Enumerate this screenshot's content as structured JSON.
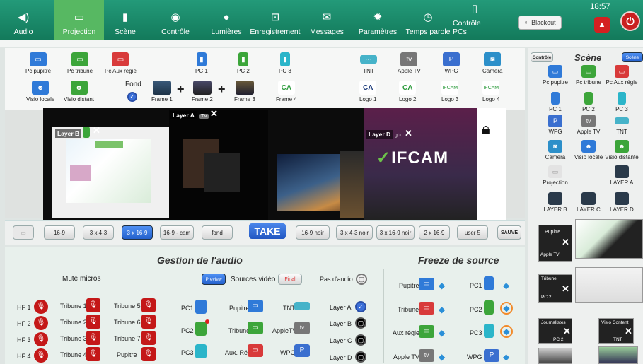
{
  "nav": [
    {
      "label": "Audio",
      "icon": "speaker-icon",
      "glyph": "◀)"
    },
    {
      "label": "Projection",
      "icon": "projector-icon",
      "glyph": "▭"
    },
    {
      "label": "Scène",
      "icon": "screen-icon",
      "glyph": "▮"
    },
    {
      "label": "Contrôle",
      "icon": "eye-icon",
      "glyph": "◉"
    },
    {
      "label": "Lumières",
      "icon": "bulb-icon",
      "glyph": "●"
    },
    {
      "label": "Enregistrement",
      "icon": "record-icon",
      "glyph": "⊡"
    },
    {
      "label": "Messages",
      "icon": "envelope-icon",
      "glyph": "✉"
    },
    {
      "label": "Paramètres",
      "icon": "gear-icon",
      "glyph": "✹"
    },
    {
      "label": "Temps parole",
      "icon": "clock-icon",
      "glyph": "◷"
    },
    {
      "label": "Contrôle PCs",
      "icon": "mouse-icon",
      "glyph": "▯"
    }
  ],
  "blackout": "Blackout",
  "time": "18:57",
  "sources_row1": [
    "Pc pupitre",
    "Pc tribune",
    "Pc Aux régie",
    "PC 1",
    "PC 2",
    "PC 3",
    "TNT",
    "Apple TV",
    "WPG",
    "Camera"
  ],
  "sources_row2": {
    "visio_locale": "Visio locale",
    "visio_distant": "Visio distant",
    "fond": "Fond",
    "frame1": "Frame 1",
    "frame2": "Frame 2",
    "frame3": "Frame 3",
    "frame4": "Frame 4",
    "logo1": "Logo 1",
    "logo2": "Logo 2",
    "logo3": "Logo 3",
    "logo4": "Logo 4",
    "plus": "+"
  },
  "layers": {
    "a": "Layer A",
    "b": "Layer B",
    "d": "Layer D",
    "ifcam": "IFCAM",
    "x": "✕",
    "tv_badge": "TV",
    "gtx_badge": "gtx"
  },
  "presets": [
    "16-9",
    "3 x 4-3",
    "3 x 16-9",
    "16-9 - cam",
    "fond",
    "16-9 noir",
    "3 x 4-3 noir",
    "3 x 16-9 noir",
    "2 x 16-9",
    "user 5",
    "SAUVE"
  ],
  "take": "TAKE",
  "audio": {
    "title": "Gestion de l'audio",
    "mute": "Mute micros",
    "hf": [
      "HF 1",
      "HF 2",
      "HF 3",
      "HF 4"
    ],
    "tribune_left": [
      "Tribune 1",
      "Tribune 2",
      "Tribune 3",
      "Tribune 4"
    ],
    "tribune_right": [
      "Tribune 5",
      "Tribune 6",
      "Tribune 7",
      "Pupitre"
    ],
    "preview_btn": "Preview",
    "sources_video": "Sources vidéo",
    "final_btn": "Final",
    "pas_audio": "Pas d'audio",
    "col1": [
      "PC1",
      "PC2",
      "PC3"
    ],
    "col2": [
      "Pupitre",
      "Tribune",
      "Aux. Rég"
    ],
    "col3": [
      "TNT",
      "AppleTV",
      "WPG"
    ],
    "layers": [
      "Layer A",
      "Layer B",
      "Layer C",
      "Layer D"
    ]
  },
  "freeze": {
    "title": "Freeze de source",
    "left": [
      "Pupitre",
      "Tribune",
      "Aux régie",
      "Apple TV"
    ],
    "right": [
      "PC1",
      "PC2",
      "PC3",
      "WPG"
    ]
  },
  "right": {
    "controle": "Contrôle",
    "scene_title": "Scène",
    "scene_btn": "Scène",
    "items": [
      "Pc pupitre",
      "Pc tribune",
      "Pc Aux régie",
      "PC 1",
      "PC 2",
      "PC 3",
      "WPG",
      "Apple TV",
      "TNT",
      "Camera",
      "Visio locale",
      "Visio distante",
      "Projection",
      "LAYER A",
      "LAYER B",
      "LAYER C",
      "LAYER D"
    ],
    "thumbs": {
      "pupitre": "Pupitre",
      "appletv": "Apple TV",
      "tribune": "Tribune",
      "pc2a": "PC 2",
      "journalistes": "Journalistes",
      "pc2b": "PC 2",
      "visio": "Visio Content",
      "tnt": "TNT"
    }
  },
  "colors": {
    "nav_green": "#1a8c6b",
    "active": "#57b862",
    "take": "#2a63cf",
    "mute": "#c41818"
  }
}
